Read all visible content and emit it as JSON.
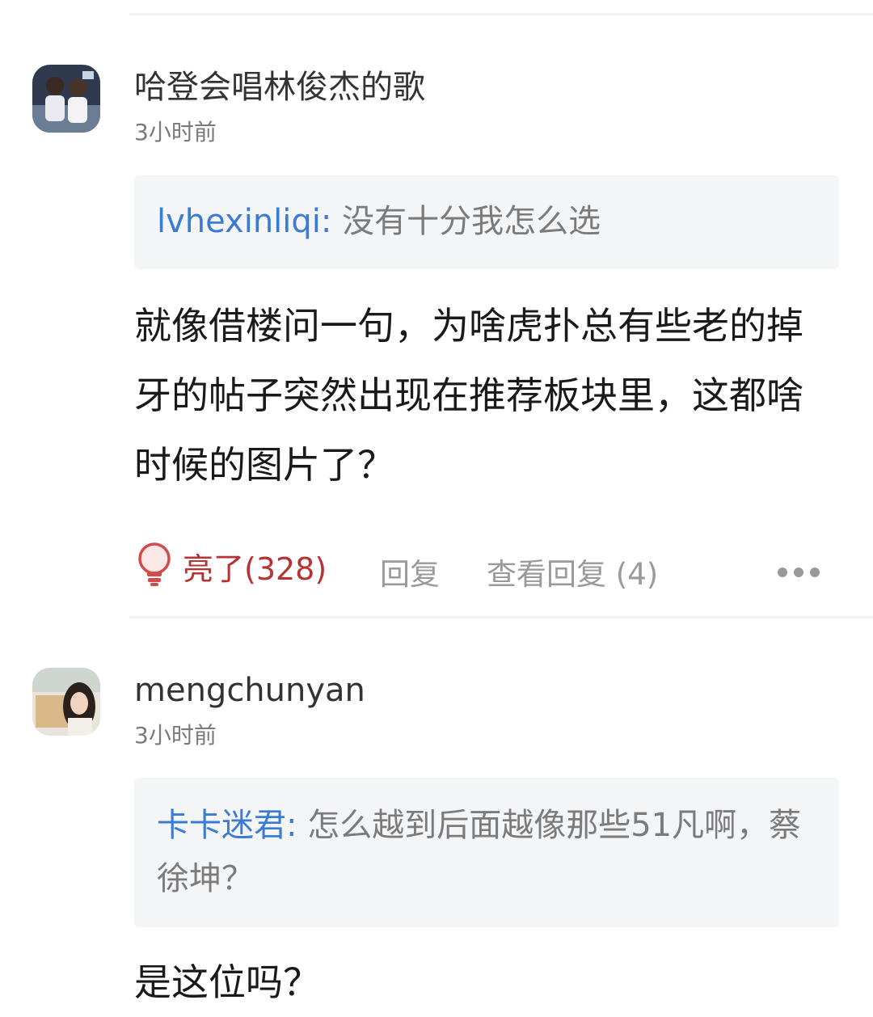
{
  "comments": [
    {
      "username": "哈登会唱林俊杰的歌",
      "time": "3小时前",
      "quote_user": "lvhexinliqi:",
      "quote_text": " 没有十分我怎么选",
      "body": "就像借楼问一句，为啥虎扑总有些老的掉牙的帖子突然出现在推荐板块里，这都啥时候的图片了？",
      "like_label": "亮了(328)",
      "reply_label": "回复",
      "view_replies_label": "查看回复 (4)"
    },
    {
      "username": "mengchunyan",
      "time": "3小时前",
      "quote_user": "卡卡迷君:",
      "quote_text": " 怎么越到后面越像那些51凡啊，蔡徐坤？",
      "body": "是这位吗？"
    }
  ],
  "colors": {
    "quote_name": "#3a7bd5",
    "like": "#b73232",
    "muted": "#9a9a9a",
    "quote_bg": "#f4f5f7"
  },
  "icons": {
    "like": "lightbulb-icon",
    "more": "more-dots-icon"
  }
}
